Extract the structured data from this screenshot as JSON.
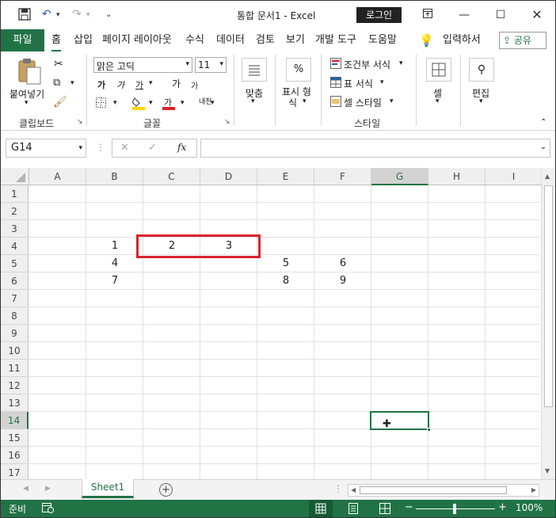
{
  "titlebar": {
    "document_title": "통합 문서1  -  Excel",
    "login_label": "로그인"
  },
  "tabs": {
    "file": "파일",
    "items": [
      "홈",
      "삽입",
      "페이지 레이아웃",
      "수식",
      "데이터",
      "검토",
      "보기",
      "개발 도구",
      "도움말"
    ],
    "tell_me": "입력하서",
    "share": "공유"
  },
  "ribbon": {
    "clipboard": {
      "paste": "붙여넣기",
      "group": "클립보드"
    },
    "font": {
      "name": "맑은 고딕",
      "size": "11",
      "group": "글꼴",
      "bold": "가",
      "italic": "가",
      "underline": "가",
      "grow": "가",
      "shrink": "가",
      "color": "가",
      "phonetic": "내천"
    },
    "alignment": {
      "label": "맞춤"
    },
    "number": {
      "label1": "표시 형",
      "label2": "식",
      "percent": "%"
    },
    "styles": {
      "conditional": "조건부 서식",
      "table": "표 서식",
      "cell": "셀 스타일",
      "group": "스타일"
    },
    "cells": {
      "label": "셀"
    },
    "editing": {
      "label": "편집"
    }
  },
  "formula_bar": {
    "name_box": "G14",
    "fx": "fx",
    "formula": ""
  },
  "columns": [
    "A",
    "B",
    "C",
    "D",
    "E",
    "F",
    "G",
    "H",
    "I"
  ],
  "rows": [
    "1",
    "2",
    "3",
    "4",
    "5",
    "6",
    "7",
    "8",
    "9",
    "10",
    "11",
    "12",
    "13",
    "14",
    "15",
    "16",
    "17"
  ],
  "cells": {
    "B4": "1",
    "C4": "2",
    "D4": "3",
    "B5": "4",
    "E5": "5",
    "F5": "6",
    "B6": "7",
    "E6": "8",
    "F6": "9"
  },
  "sheet": {
    "tab": "Sheet1"
  },
  "status": {
    "ready": "준비",
    "zoom": "100%"
  },
  "colors": {
    "excel_green": "#217346",
    "highlight_red": "#d9232d"
  }
}
